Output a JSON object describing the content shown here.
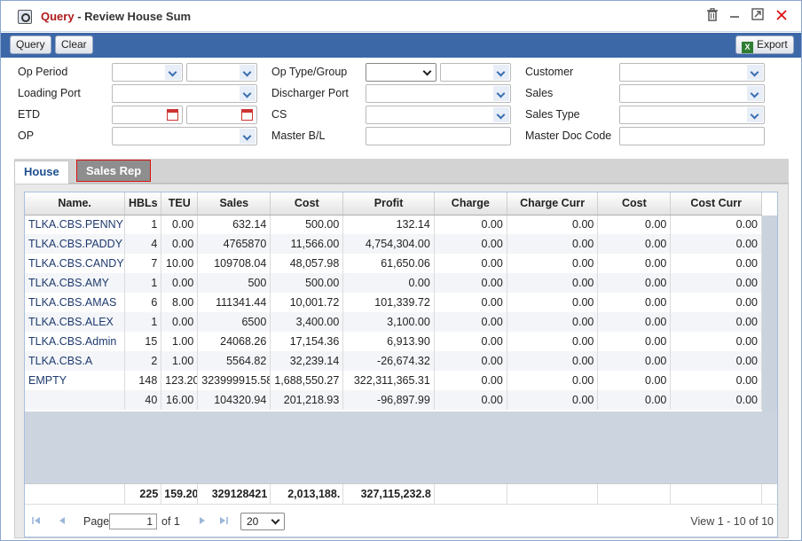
{
  "window": {
    "title_prefix": "Query",
    "title_sep": " - ",
    "title_main": "Review House Sum"
  },
  "toolbar": {
    "query_label": "Query",
    "clear_label": "Clear",
    "export_label": "Export"
  },
  "filters": {
    "op_period": "Op Period",
    "loading_port": "Loading Port",
    "etd": "ETD",
    "op": "OP",
    "op_type_group": "Op Type/Group",
    "discharger_port": "Discharger Port",
    "cs": "CS",
    "master_bl": "Master B/L",
    "customer": "Customer",
    "sales": "Sales",
    "sales_type": "Sales Type",
    "master_doc_code": "Master Doc Code"
  },
  "tabs": [
    {
      "label": "House"
    },
    {
      "label": "Sales Rep"
    }
  ],
  "grid": {
    "columns": [
      "Name.",
      "HBLs",
      "TEU",
      "Sales",
      "Cost",
      "Profit",
      "Charge",
      "Charge Curr",
      "Cost",
      "Cost Curr"
    ],
    "rows": [
      [
        "TLKA.CBS.PENNY",
        "1",
        "0.00",
        "632.14",
        "500.00",
        "132.14",
        "0.00",
        "0.00",
        "0.00",
        "0.00"
      ],
      [
        "TLKA.CBS.PADDY",
        "4",
        "0.00",
        "4765870",
        "11,566.00",
        "4,754,304.00",
        "0.00",
        "0.00",
        "0.00",
        "0.00"
      ],
      [
        "TLKA.CBS.CANDY",
        "7",
        "10.00",
        "109708.04",
        "48,057.98",
        "61,650.06",
        "0.00",
        "0.00",
        "0.00",
        "0.00"
      ],
      [
        "TLKA.CBS.AMY",
        "1",
        "0.00",
        "500",
        "500.00",
        "0.00",
        "0.00",
        "0.00",
        "0.00",
        "0.00"
      ],
      [
        "TLKA.CBS.AMAS",
        "6",
        "8.00",
        "111341.44",
        "10,001.72",
        "101,339.72",
        "0.00",
        "0.00",
        "0.00",
        "0.00"
      ],
      [
        "TLKA.CBS.ALEX",
        "1",
        "0.00",
        "6500",
        "3,400.00",
        "3,100.00",
        "0.00",
        "0.00",
        "0.00",
        "0.00"
      ],
      [
        "TLKA.CBS.Admin",
        "15",
        "1.00",
        "24068.26",
        "17,154.36",
        "6,913.90",
        "0.00",
        "0.00",
        "0.00",
        "0.00"
      ],
      [
        "TLKA.CBS.A",
        "2",
        "1.00",
        "5564.82",
        "32,239.14",
        "-26,674.32",
        "0.00",
        "0.00",
        "0.00",
        "0.00"
      ],
      [
        "EMPTY",
        "148",
        "123.20",
        "323999915.58",
        "1,688,550.27",
        "322,311,365.31",
        "0.00",
        "0.00",
        "0.00",
        "0.00"
      ],
      [
        "",
        "40",
        "16.00",
        "104320.94",
        "201,218.93",
        "-96,897.99",
        "0.00",
        "0.00",
        "0.00",
        "0.00"
      ]
    ],
    "totals": [
      "",
      "225",
      "159.20",
      "329128421",
      "2,013,188.",
      "327,115,232.8",
      "",
      "",
      "",
      ""
    ]
  },
  "pager": {
    "page_label": "Page",
    "page_value": "1",
    "of_label": "of 1",
    "page_size": "20",
    "view_text": "View 1 - 10 of 10"
  },
  "colors": {
    "toolbar": "#3d68a8",
    "title_prefix": "#b01a1a",
    "close": "#dd1111"
  }
}
